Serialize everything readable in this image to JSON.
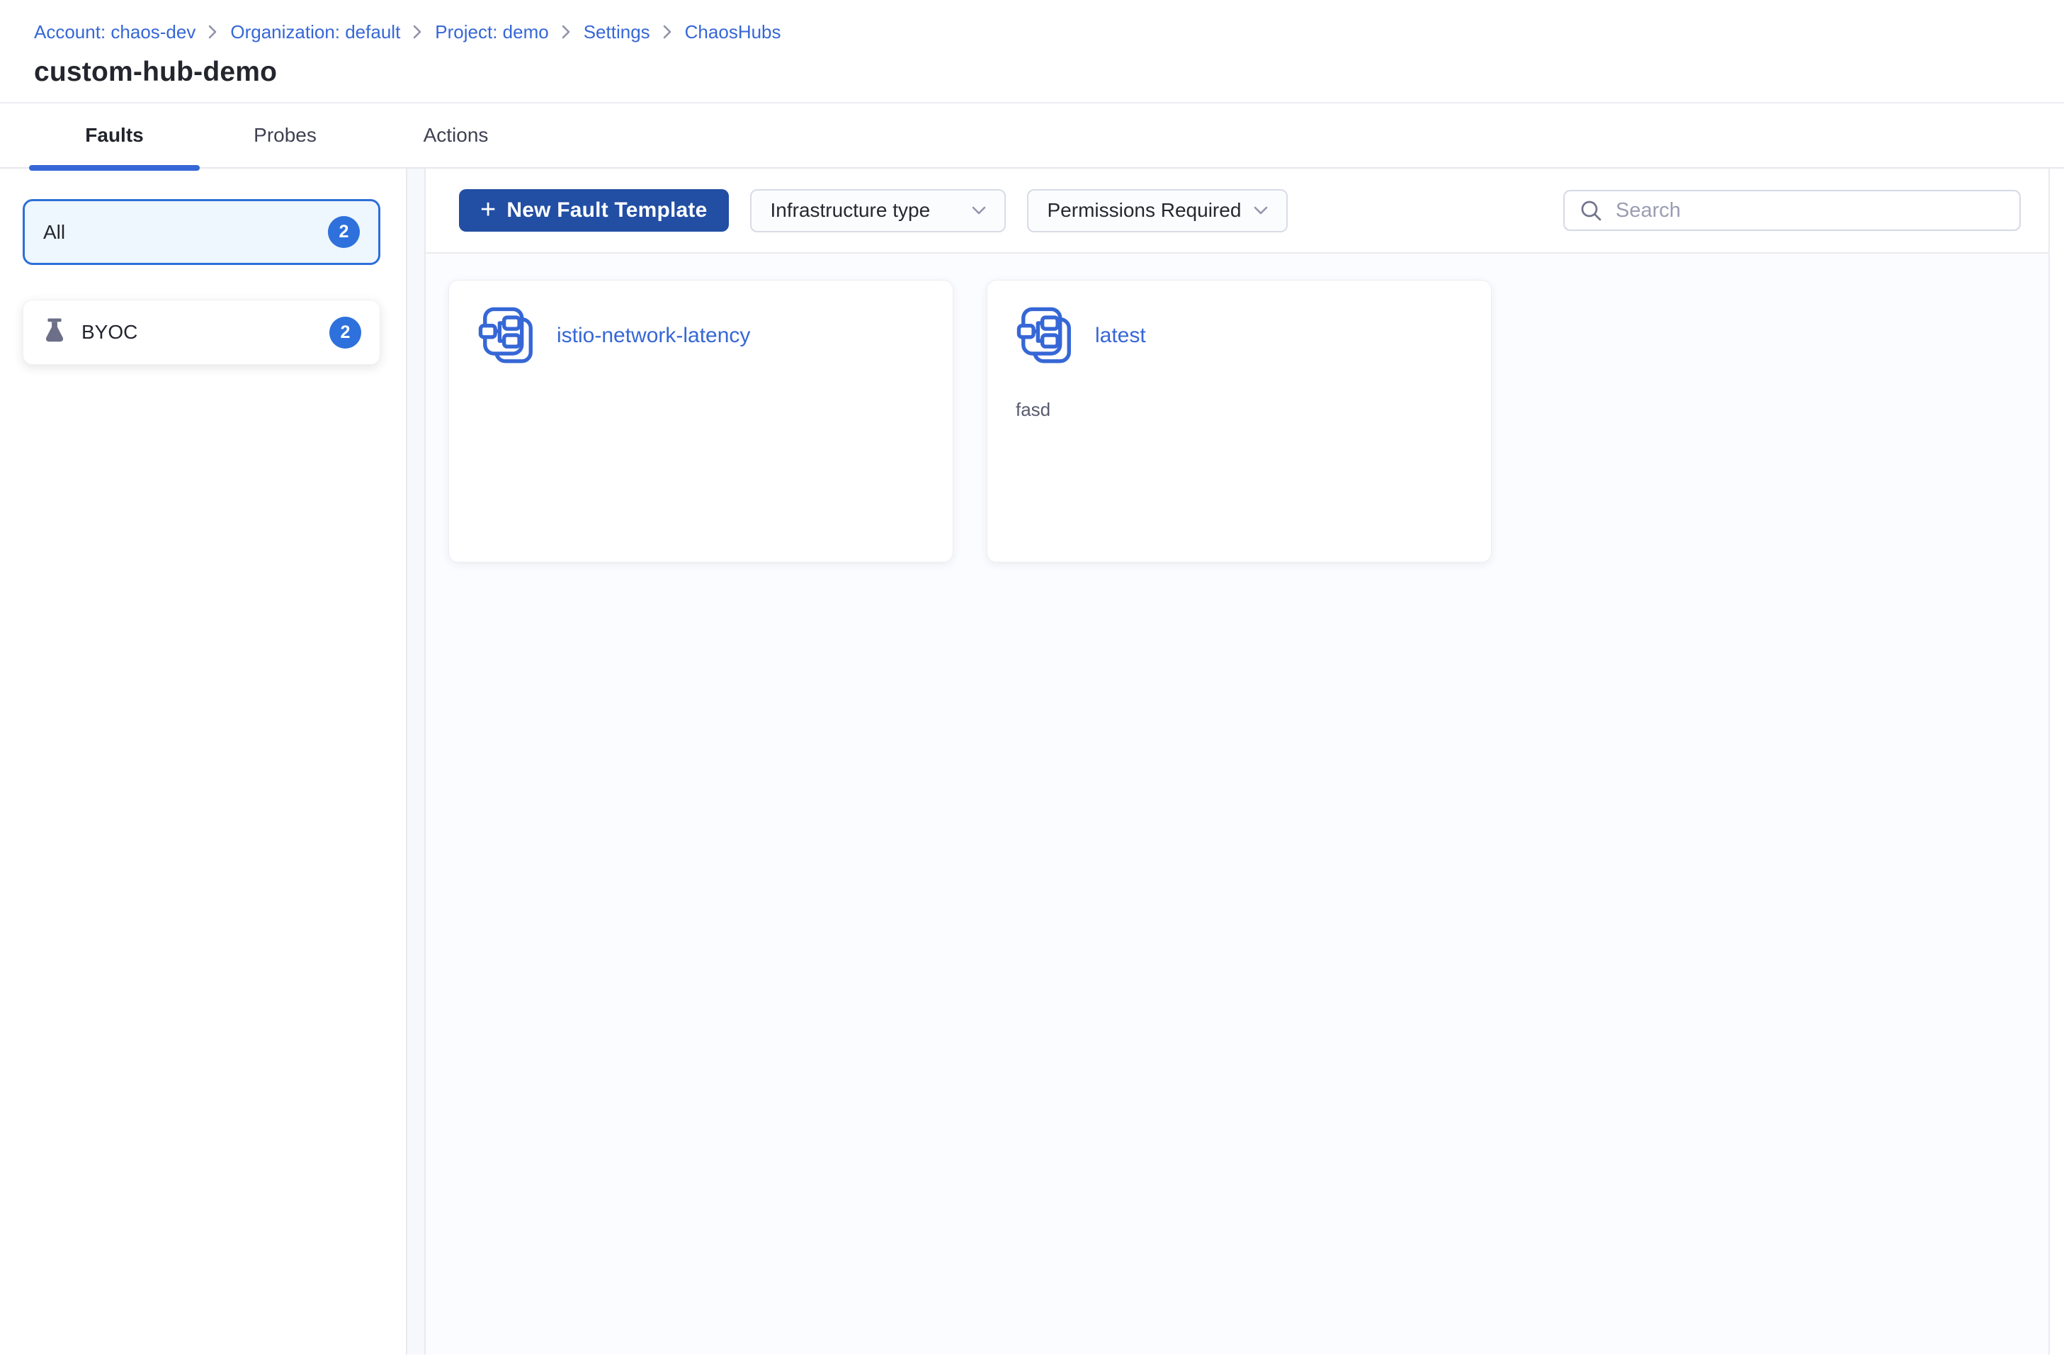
{
  "colors": {
    "link_blue": "#3667d6",
    "button_blue": "#224ea3",
    "badge_blue": "#2e71dc",
    "selected_filter_border": "#2e6fd9",
    "selected_filter_bg": "#eef7fd",
    "tab_underline": "#3667d6"
  },
  "breadcrumb": {
    "items": [
      "Account: chaos-dev",
      "Organization: default",
      "Project: demo",
      "Settings",
      "ChaosHubs"
    ]
  },
  "page": {
    "title": "custom-hub-demo"
  },
  "tabs": [
    {
      "label": "Faults",
      "active": true
    },
    {
      "label": "Probes",
      "active": false
    },
    {
      "label": "Actions",
      "active": false
    }
  ],
  "sidebar": {
    "filters": [
      {
        "label": "All",
        "count": "2",
        "selected": true
      },
      {
        "label": "BYOC",
        "count": "2",
        "selected": false,
        "icon": "flask-icon"
      }
    ]
  },
  "toolbar": {
    "plus": "+",
    "new_button_label": "New Fault Template",
    "infra_filter_label": "Infrastructure type",
    "permissions_filter_label": "Permissions Required",
    "search_placeholder": "Search"
  },
  "cards": [
    {
      "title": "istio-network-latency",
      "description": ""
    },
    {
      "title": "latest",
      "description": "fasd"
    }
  ]
}
